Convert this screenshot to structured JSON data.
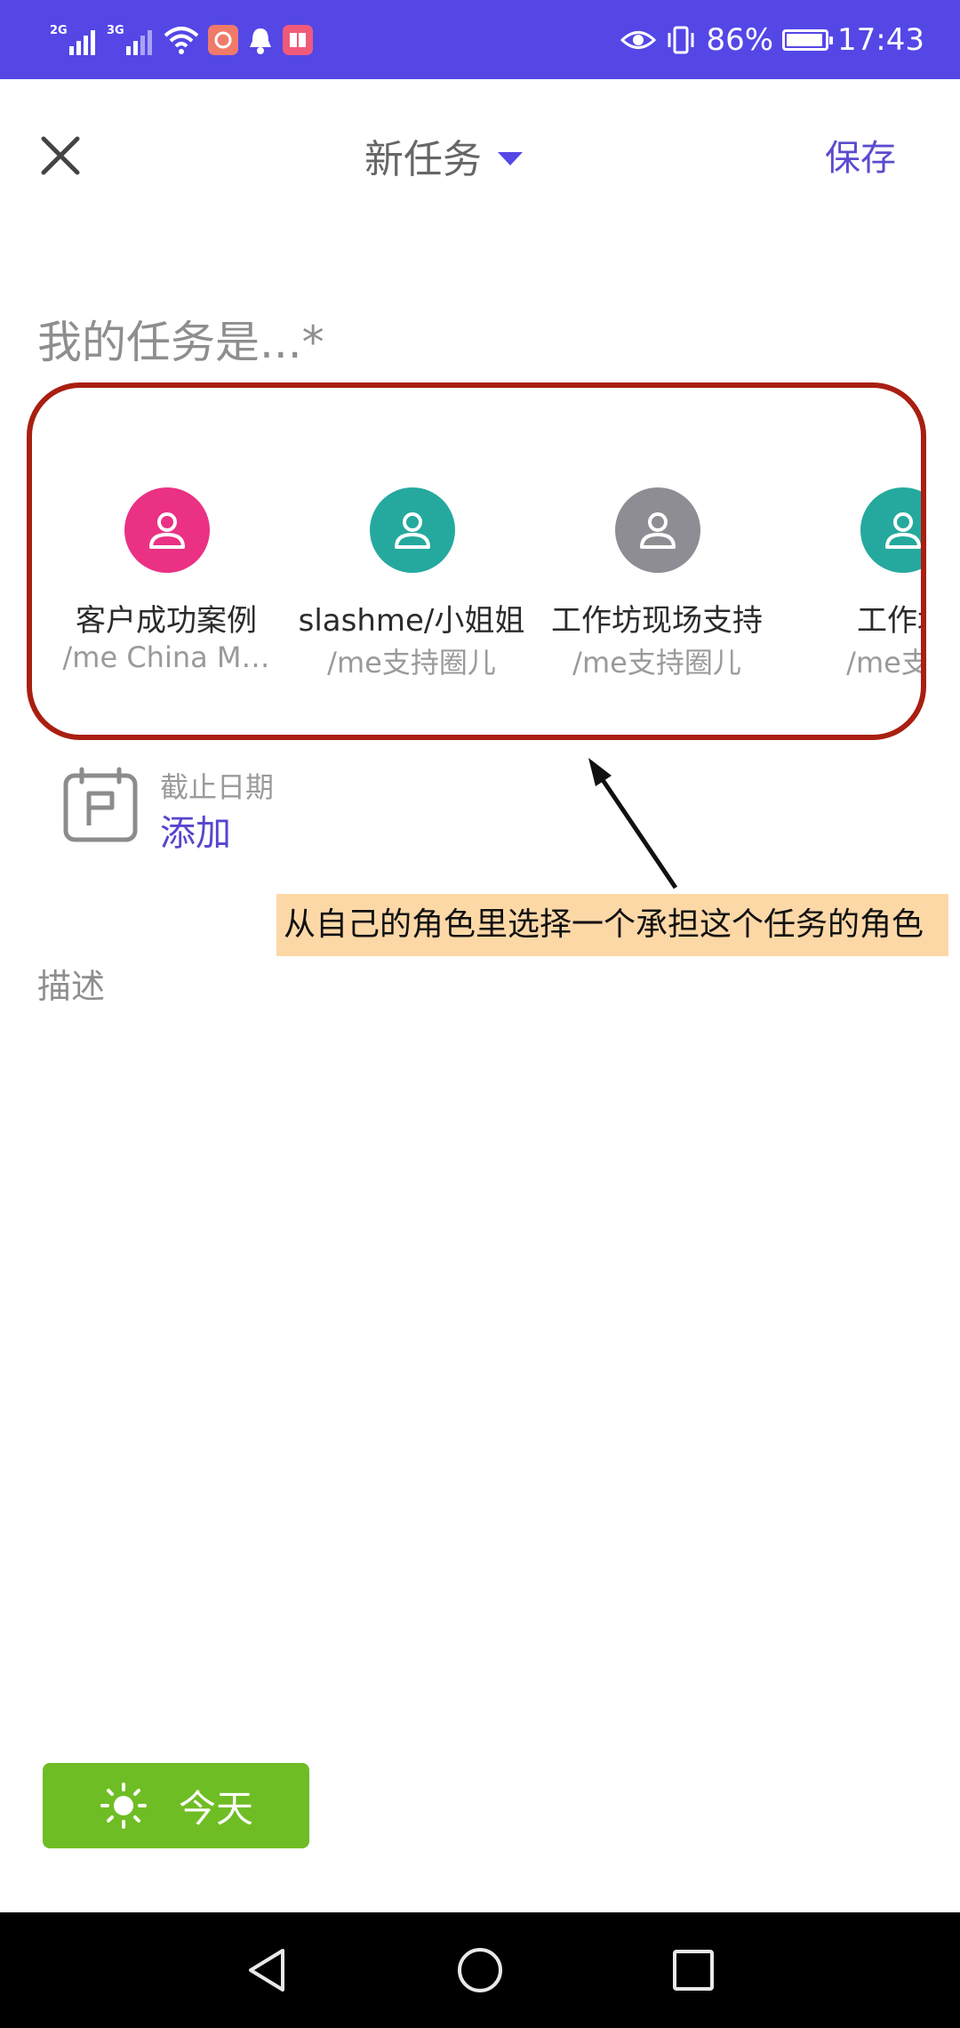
{
  "status_bar": {
    "network_1": "2G",
    "network_2": "3G",
    "battery_percent": "86%",
    "time": "17:43",
    "battery_level": 0.86
  },
  "header": {
    "title": "新任务",
    "save_label": "保存"
  },
  "task_input": {
    "placeholder": "我的任务是...*"
  },
  "roles": [
    {
      "name": "客户成功案例",
      "sub": "/me China M…",
      "color": "#ea3184"
    },
    {
      "name": "slashme/小姐姐",
      "sub": "/me支持圈儿",
      "color": "#25a99e"
    },
    {
      "name": "工作坊现场支持",
      "sub": "/me支持圈儿",
      "color": "#8e8d94"
    },
    {
      "name": "工作坊",
      "sub": "/me支持",
      "color": "#25a99e"
    }
  ],
  "due_date": {
    "label": "截止日期",
    "action": "添加"
  },
  "annotation": {
    "text": "从自己的角色里选择一个承担这个任务的角色"
  },
  "description": {
    "label": "描述"
  },
  "today_button": {
    "label": "今天"
  },
  "colors": {
    "status_bar": "#5447e6",
    "accent": "#5546cf",
    "today_green": "#6fbd24",
    "highlight_border": "#a91f12",
    "annotation_bg": "#fdd8a7"
  }
}
